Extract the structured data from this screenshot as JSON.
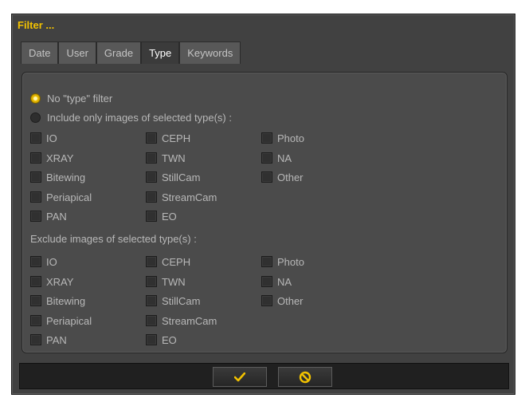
{
  "dialog": {
    "title": "Filter ..."
  },
  "tabs": [
    {
      "label": "Date",
      "active": false
    },
    {
      "label": "User",
      "active": false
    },
    {
      "label": "Grade",
      "active": false
    },
    {
      "label": "Type",
      "active": true
    },
    {
      "label": "Keywords",
      "active": false
    }
  ],
  "mode": {
    "no_filter_label": "No \"type\" filter",
    "include_label": "Include only images of selected type(s) :",
    "selected": "no_filter"
  },
  "include_types": {
    "col1": [
      "IO",
      "XRAY",
      "Bitewing",
      "Periapical",
      "PAN"
    ],
    "col2": [
      "CEPH",
      "TWN",
      "StillCam",
      "StreamCam",
      "EO"
    ],
    "col3": [
      "Photo",
      "NA",
      "Other"
    ]
  },
  "exclude": {
    "label": "Exclude images of selected type(s) :",
    "col1": [
      "IO",
      "XRAY",
      "Bitewing",
      "Periapical",
      "PAN"
    ],
    "col2": [
      "CEPH",
      "TWN",
      "StillCam",
      "StreamCam",
      "EO"
    ],
    "col3": [
      "Photo",
      "NA",
      "Other"
    ]
  },
  "colors": {
    "accent": "#f2c200",
    "background": "#414141",
    "panel": "#4b4b4b"
  },
  "footer": {
    "ok_icon": "checkmark-icon",
    "cancel_icon": "cancel-icon"
  }
}
